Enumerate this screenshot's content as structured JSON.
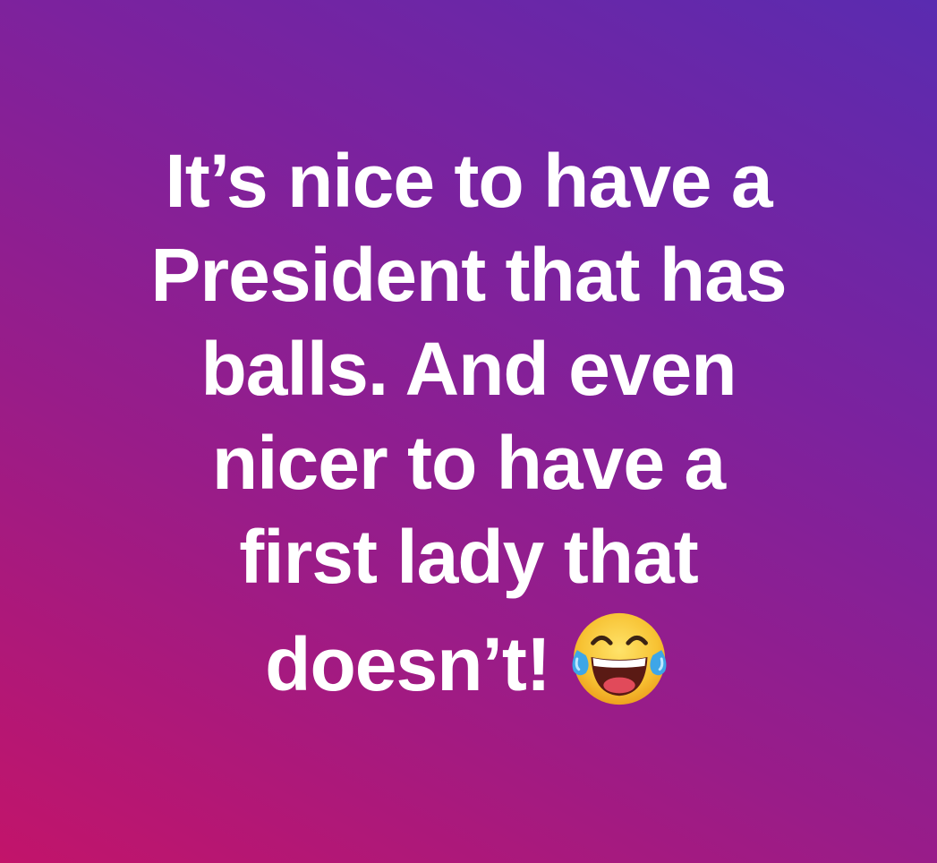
{
  "post": {
    "lines": [
      "It’s nice to have a",
      "President that has",
      "balls. And even",
      "nicer to have a",
      "first lady that",
      "doesn’t!"
    ],
    "emoji": "face-with-tears-of-joy-icon"
  },
  "colors": {
    "background_top_right": "#5a2bb0",
    "background_bottom_left": "#c2146a",
    "text": "#ffffff"
  }
}
